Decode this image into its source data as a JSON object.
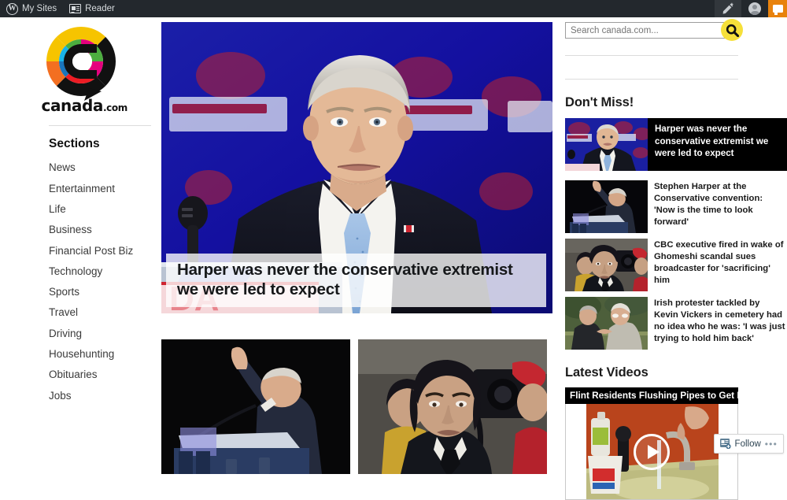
{
  "adminbar": {
    "wp_logo_glyph": "W",
    "wp_logo_icon": "wordpress-logo-icon",
    "my_sites_label": "My Sites",
    "reader_label": "Reader",
    "edit_icon": "edit-pencil-icon",
    "avatar_icon": "user-avatar-icon",
    "notifications_icon": "notifications-bubble-icon",
    "bar_color": "#23282d",
    "notif_color": "#e8820c"
  },
  "brand": {
    "name": "canada",
    "suffix": ".com",
    "logo_icon": "canada-com-ring-logo-icon",
    "ring_colors": [
      "#f6c400",
      "#e5007d",
      "#4cae3f",
      "#19b3e8",
      "#1b75bb",
      "#ed1c24",
      "#f36f21",
      "#111111"
    ]
  },
  "sidebar": {
    "heading": "Sections",
    "items": [
      {
        "label": "News"
      },
      {
        "label": "Entertainment"
      },
      {
        "label": "Life"
      },
      {
        "label": "Business"
      },
      {
        "label": "Financial Post Biz"
      },
      {
        "label": "Technology"
      },
      {
        "label": "Sports"
      },
      {
        "label": "Travel"
      },
      {
        "label": "Driving"
      },
      {
        "label": "Househunting"
      },
      {
        "label": "Obituaries"
      },
      {
        "label": "Jobs"
      }
    ]
  },
  "search": {
    "placeholder": "Search canada.com...",
    "value": "",
    "button_icon": "search-magnifier-icon",
    "button_color": "#f6e03a"
  },
  "hero": {
    "headline": "Harper was never the conservative extremist we were led to expect",
    "image_alt": "Stephen Harper in a dark suit and light blue tie in front of a blue Conservative backdrop with red logos"
  },
  "thumbnails": [
    {
      "image_alt": "Stephen Harper waving with his hand raised while leaning over a podium on a dark stage"
    },
    {
      "image_alt": "Jian Ghomeshi in a dark suit looking down, surrounded by news cameras and a person in a red coat"
    }
  ],
  "dont_miss": {
    "title": "Don't Miss!",
    "items": [
      {
        "headline": "Harper was never the conservative extremist we were led to expect",
        "featured": true,
        "image_alt": "Stephen Harper at a podium in front of a blue backdrop"
      },
      {
        "headline": "Stephen Harper at the Conservative convention: 'Now is the time to look forward'",
        "featured": false,
        "image_alt": "Harper waving at a podium on a dark stage"
      },
      {
        "headline": "CBC executive fired in wake of Ghomeshi scandal sues broadcaster for 'sacrificing' him",
        "featured": false,
        "image_alt": "Dark haired man in a suit outside with a person in red behind"
      },
      {
        "headline": "Irish protester tackled by Kevin Vickers in cemetery had no idea who he was: 'I was just trying to hold him back'",
        "featured": false,
        "image_alt": "Two older men in a scuffle on green grass"
      }
    ]
  },
  "latest_videos": {
    "title": "Latest Videos",
    "video": {
      "title": "Flint Residents Flushing Pipes to Get Lead Out",
      "play_icon": "play-button-icon",
      "image_alt": "Kitchen sink with running faucet against an orange wall and cleaning supplies"
    }
  },
  "follow_widget": {
    "label": "Follow",
    "icon": "follow-plus-icon",
    "more_label": "•••"
  }
}
